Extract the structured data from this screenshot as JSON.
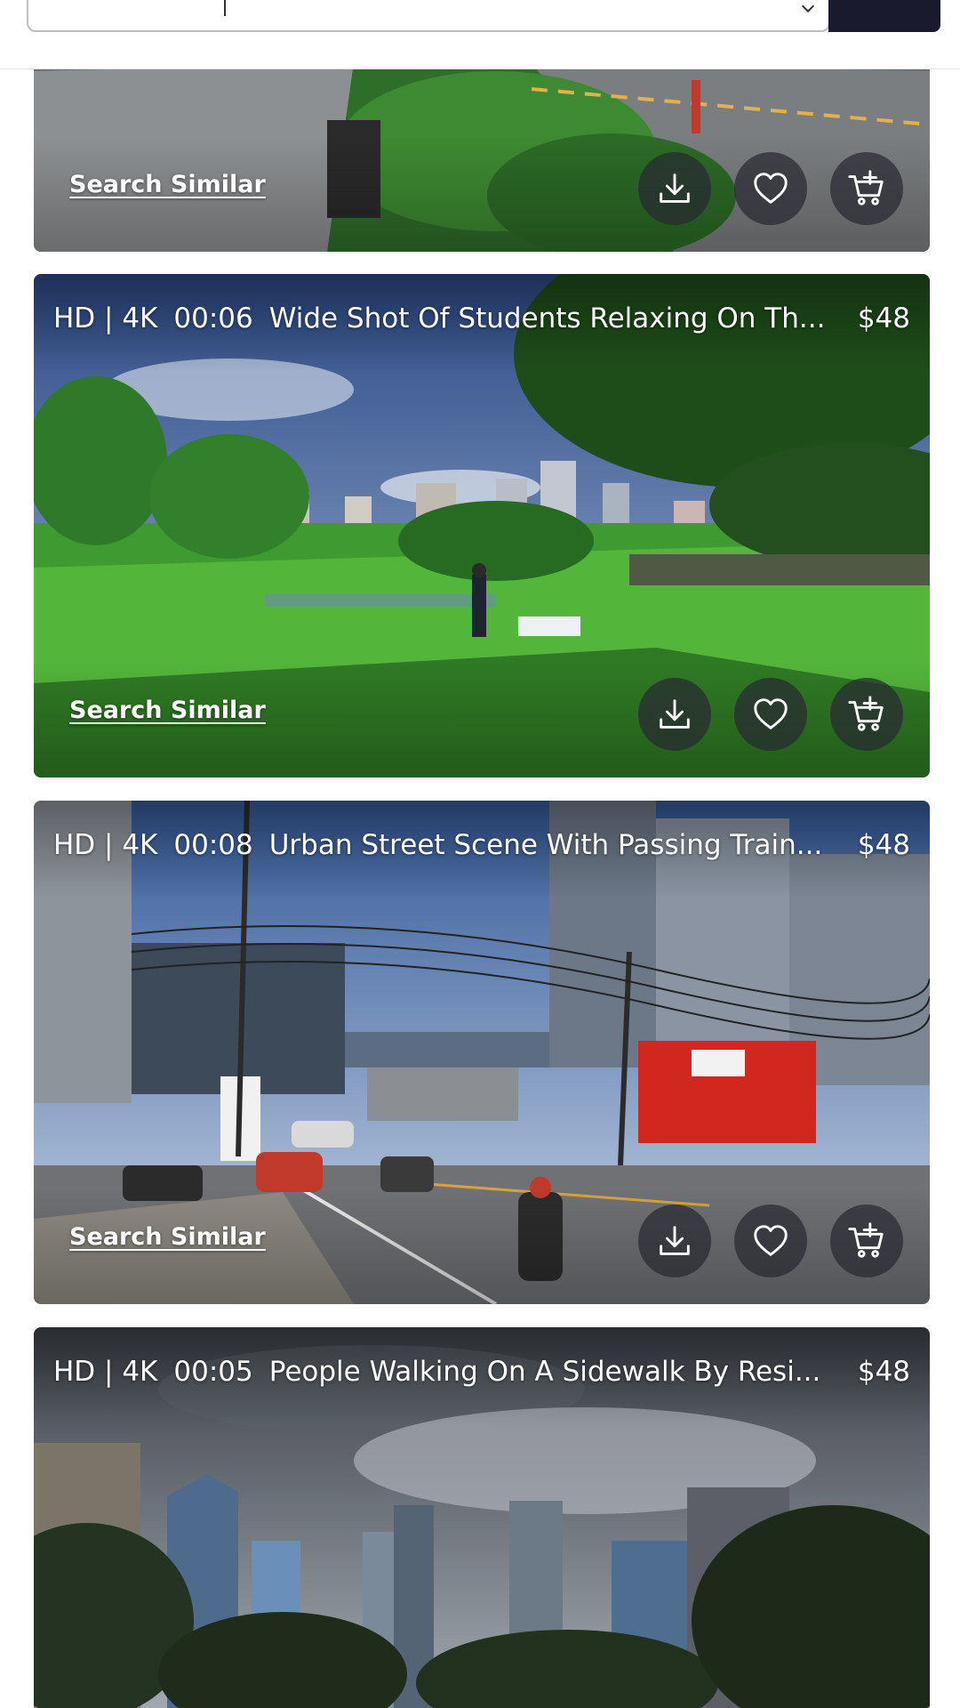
{
  "search": {
    "placeholder": ""
  },
  "cards": [
    {
      "format": "",
      "duration": "",
      "title": "",
      "price": "",
      "search_similar": "Search Similar"
    },
    {
      "format": "HD | 4K",
      "duration": "00:06",
      "title": "Wide Shot Of Students Relaxing On Th...",
      "price": "$48",
      "search_similar": "Search Similar"
    },
    {
      "format": "HD | 4K",
      "duration": "00:08",
      "title": "Urban Street Scene With Passing Train...",
      "price": "$48",
      "search_similar": "Search Similar"
    },
    {
      "format": "HD | 4K",
      "duration": "00:05",
      "title": "People Walking On A Sidewalk By Resi...",
      "price": "$48",
      "search_similar": ""
    }
  ],
  "icons": {
    "download": "download-icon",
    "favorite": "heart-icon",
    "cart": "add-to-cart-icon",
    "chevron": "chevron-down-icon"
  },
  "colors": {
    "overlay_text": "#ffffff",
    "action_bg": "#28283280",
    "search_button": "#1a1a2e"
  }
}
